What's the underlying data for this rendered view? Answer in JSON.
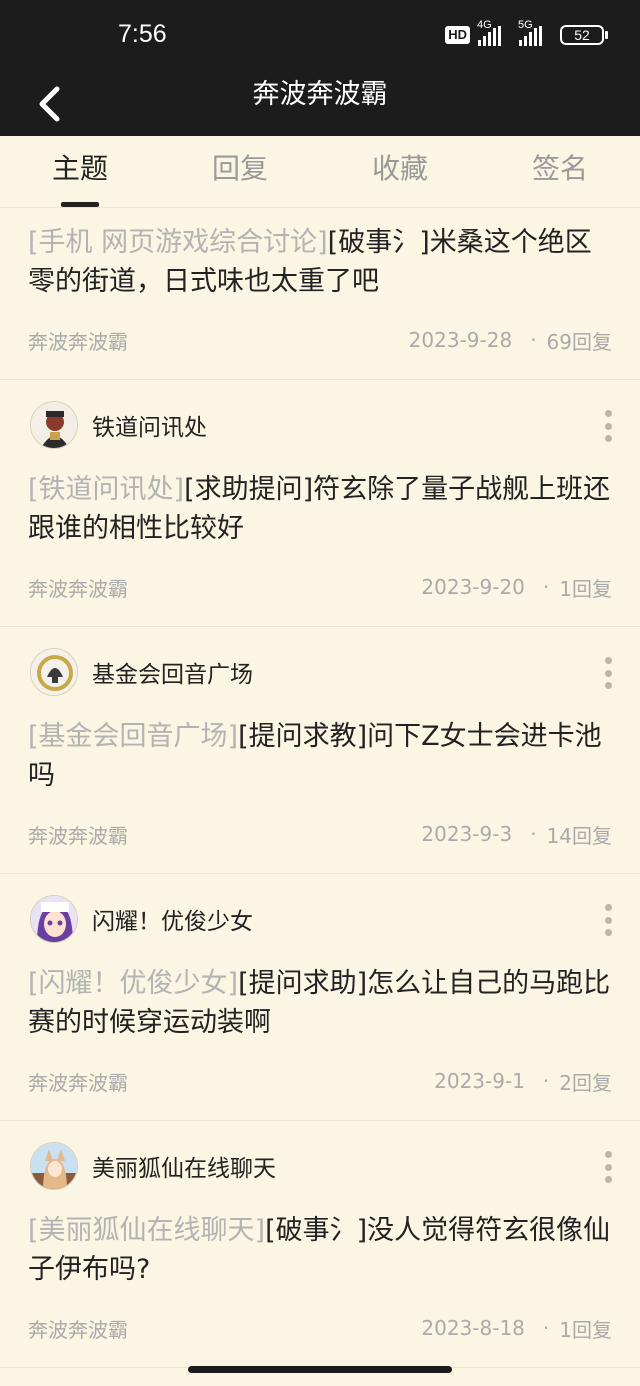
{
  "status": {
    "time": "7:56",
    "hd": "HD",
    "net1": "4G",
    "net2": "5G",
    "battery": "52"
  },
  "header": {
    "title": "奔波奔波霸"
  },
  "tabs": [
    "主题",
    "回复",
    "收藏",
    "签名"
  ],
  "posts": [
    {
      "forum": "",
      "tag": "[手机 网页游戏综合讨论]",
      "title": "[破事氵]米桑这个绝区零的街道，日式味也太重了吧",
      "author": "奔波奔波霸",
      "date": "2023-9-28",
      "replies": "69回复"
    },
    {
      "forum": "铁道问讯处",
      "tag": "[铁道问讯处]",
      "title": "[求助提问]符玄除了量子战舰上班还跟谁的相性比较好",
      "author": "奔波奔波霸",
      "date": "2023-9-20",
      "replies": "1回复"
    },
    {
      "forum": "基金会回音广场",
      "tag": "[基金会回音广场]",
      "title": "[提问求教]问下Z女士会进卡池吗",
      "author": "奔波奔波霸",
      "date": "2023-9-3",
      "replies": "14回复"
    },
    {
      "forum": "闪耀！优俊少女",
      "tag": "[闪耀！优俊少女]",
      "title": "[提问求助]怎么让自己的马跑比赛的时候穿运动装啊",
      "author": "奔波奔波霸",
      "date": "2023-9-1",
      "replies": "2回复"
    },
    {
      "forum": "美丽狐仙在线聊天",
      "tag": "[美丽狐仙在线聊天]",
      "title": "[破事氵]没人觉得符玄很像仙子伊布吗?",
      "author": "奔波奔波霸",
      "date": "2023-8-18",
      "replies": "1回复"
    }
  ],
  "meta_separator": "·",
  "icons": {
    "back": "chevron-left-icon",
    "more": "more-vertical-icon"
  },
  "colors": {
    "bar": "#1c1c1c",
    "page": "#fbf5e3",
    "tag": "#b3b3b3",
    "text": "#222222",
    "meta": "#aaaaaa"
  }
}
